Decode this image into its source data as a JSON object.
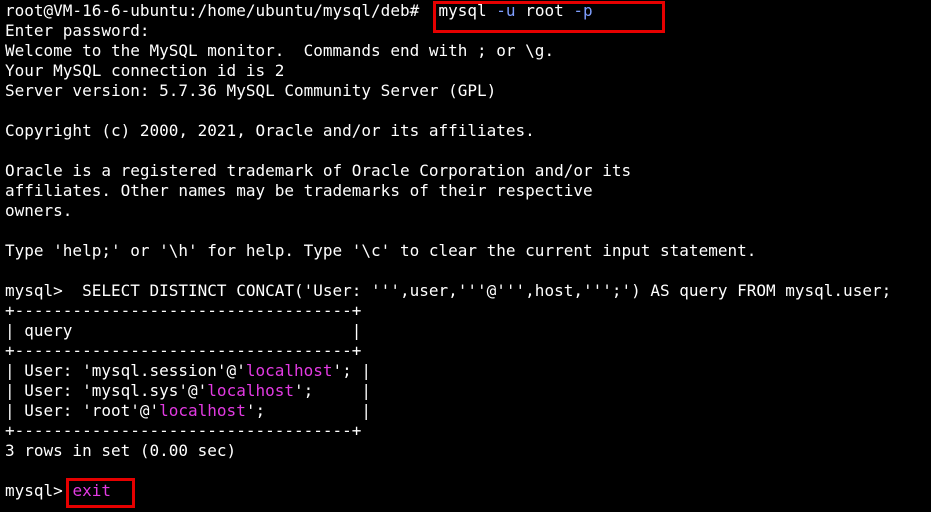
{
  "terminal": {
    "prompt_shell": "root@VM-16-6-ubuntu:/home/ubuntu/mysql/deb#",
    "command_main": "mysql",
    "command_flag_u": "-u",
    "command_user": "root",
    "command_flag_p": "-p",
    "line_enter_password": "Enter password:",
    "line_welcome": "Welcome to the MySQL monitor.  Commands end with ; or \\g.",
    "line_connection": "Your MySQL connection id is 2",
    "line_server_version": "Server version: 5.7.36 MySQL Community Server (GPL)",
    "line_copyright": "Copyright (c) 2000, 2021, Oracle and/or its affiliates.",
    "line_trademark_1": "Oracle is a registered trademark of Oracle Corporation and/or its",
    "line_trademark_2": "affiliates. Other names may be trademarks of their respective",
    "line_trademark_3": "owners.",
    "line_help": "Type 'help;' or '\\h' for help. Type '\\c' to clear the current input statement.",
    "mysql_prompt": "mysql>",
    "query": "SELECT DISTINCT CONCAT('User: ''',user,'''@''',host,''';') AS query FROM mysql.user;",
    "table_border": "+-----------------------------------+",
    "table_header": "| query                             |",
    "rows": [
      {
        "prefix": "| User: 'mysql.session'@'",
        "host": "localhost",
        "suffix": "'; |"
      },
      {
        "prefix": "| User: 'mysql.sys'@'",
        "host": "localhost",
        "suffix": "';     |"
      },
      {
        "prefix": "| User: 'root'@'",
        "host": "localhost",
        "suffix": "';          |"
      }
    ],
    "row_summary": "3 rows in set (0.00 sec)",
    "exit_command": "exit"
  },
  "colors": {
    "background": "#000000",
    "text": "#ffffff",
    "keyword_magenta": "#e23ae2",
    "highlight_box": "#e60000"
  }
}
